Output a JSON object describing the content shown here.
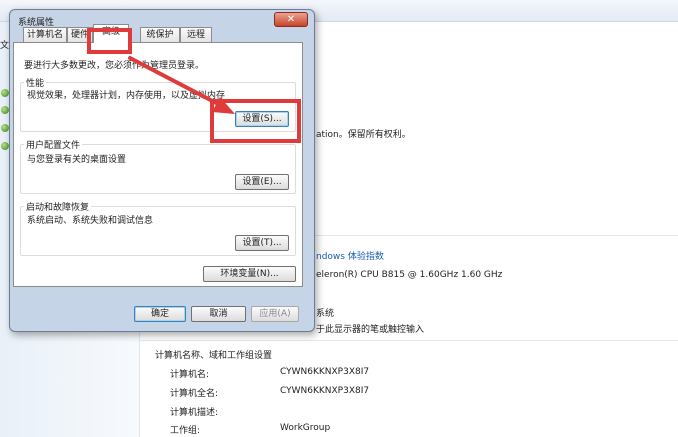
{
  "dialog": {
    "title": "系统属性",
    "close_glyph": "✕",
    "tabs": [
      {
        "label": "计算机名"
      },
      {
        "label": "硬件"
      },
      {
        "label": "高级"
      },
      {
        "label": "统保护"
      },
      {
        "label": "远程"
      }
    ],
    "admin_note": "要进行大多数更改，您必须作为管理员登录。",
    "performance": {
      "title": "性能",
      "desc": "视觉效果，处理器计划，内存使用，以及虚拟内存",
      "settings_button": "设置(S)..."
    },
    "user_profiles": {
      "title": "用户配置文件",
      "desc": "与您登录有关的桌面设置",
      "settings_button": "设置(E)..."
    },
    "startup_recovery": {
      "title": "启动和故障恢复",
      "desc": "系统启动、系统失败和调试信息",
      "settings_button": "设置(T)..."
    },
    "env_button": "环境变量(N)...",
    "ok_button": "确定",
    "cancel_button": "取消",
    "apply_button": "应用(A)"
  },
  "background": {
    "left_label": "文",
    "copyright_fragment": "ation。保留所有权利。",
    "rating_link": "ndows 体验指数",
    "cpu_text": "eleron(R) CPU B815 @ 1.60GHz   1.60 GHz",
    "system_fragment": "系统",
    "pen_text": "于此显示器的笔或触控输入",
    "section_title": "计算机名称、域和工作组设置",
    "rows": [
      {
        "label": "计算机名:",
        "value": "CYWN6KKNXP3X8I7"
      },
      {
        "label": "计算机全名:",
        "value": "CYWN6KKNXP3X8I7"
      },
      {
        "label": "计算机描述:",
        "value": ""
      },
      {
        "label": "工作组:",
        "value": "WorkGroup"
      }
    ]
  },
  "colors": {
    "annotation_red": "#e03b3b",
    "link_blue": "#1a5fb4"
  }
}
